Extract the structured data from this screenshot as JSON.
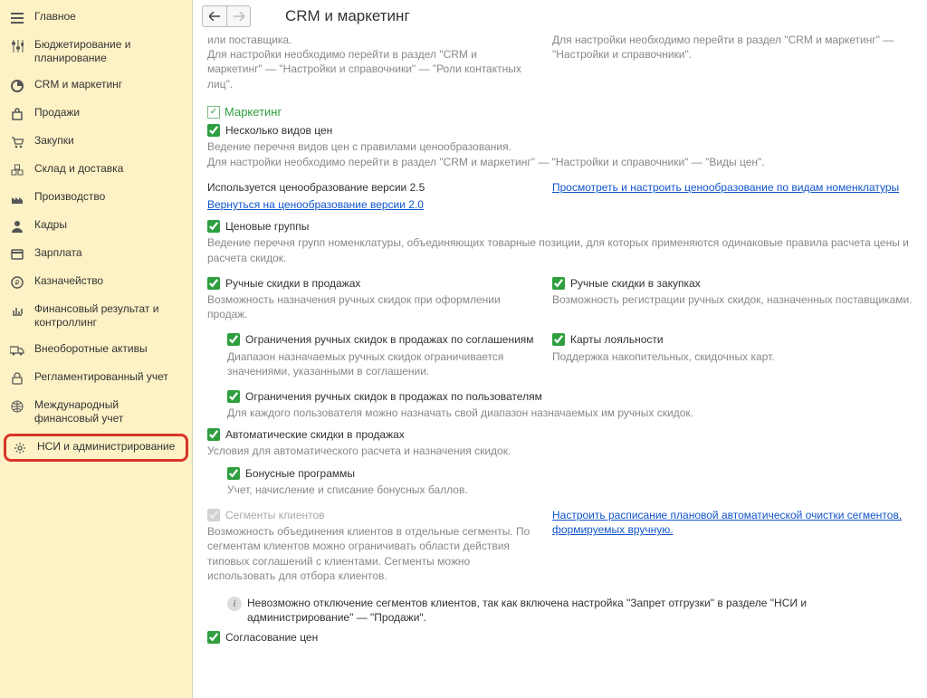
{
  "page_title": "CRM и маркетинг",
  "sidebar": [
    {
      "icon": "menu",
      "label": "Главное"
    },
    {
      "icon": "sliders",
      "label": "Бюджетирование и планирование"
    },
    {
      "icon": "pie",
      "label": "CRM и маркетинг"
    },
    {
      "icon": "bag",
      "label": "Продажи"
    },
    {
      "icon": "cart",
      "label": "Закупки"
    },
    {
      "icon": "boxes",
      "label": "Склад и доставка"
    },
    {
      "icon": "factory",
      "label": "Производство"
    },
    {
      "icon": "person",
      "label": "Кадры"
    },
    {
      "icon": "card",
      "label": "Зарплата"
    },
    {
      "icon": "coin",
      "label": "Казначейство"
    },
    {
      "icon": "chart",
      "label": "Финансовый результат и контроллинг"
    },
    {
      "icon": "truck",
      "label": "Внеоборотные активы"
    },
    {
      "icon": "lock",
      "label": "Регламентированный учет"
    },
    {
      "icon": "globe",
      "label": "Международный финансовый учет"
    },
    {
      "icon": "gear",
      "label": "НСИ и администрирование",
      "highlighted": true
    }
  ],
  "top_left_desc": "или поставщика.\nДля настройки необходимо перейти в раздел \"CRM и маркетинг\" — \"Настройки и справочники\" — \"Роли контактных лиц\".",
  "top_right_desc": "Для настройки необходимо перейти в раздел \"CRM и маркетинг\" — \"Настройки и справочники\".",
  "section_marketing": "Маркетинг",
  "cb_multiple_prices": "Несколько видов цен",
  "desc_multiple_prices": "Ведение перечня видов цен с правилами ценообразования.\nДля настройки необходимо перейти в раздел \"CRM и маркетинг\" — \"Настройки и справочники\" — \"Виды цен\".",
  "pricing_version_text": "Используется ценообразование версии 2.5",
  "pricing_version_link": "Вернуться на ценообразование версии 2.0",
  "pricing_right_link": "Просмотреть и настроить ценообразование по видам номенклатуры",
  "cb_price_groups": "Ценовые группы",
  "desc_price_groups": "Ведение перечня групп номенклатуры, объединяющих товарные позиции, для которых применяются одинаковые правила расчета цены и расчета скидок.",
  "cb_manual_sales": "Ручные скидки в продажах",
  "desc_manual_sales": "Возможность назначения ручных скидок при оформлении продаж.",
  "cb_manual_purch": "Ручные скидки в закупках",
  "desc_manual_purch": "Возможность регистрации ручных скидок, назначенных поставщиками.",
  "cb_limit_agreement": "Ограничения ручных скидок в продажах по соглашениям",
  "desc_limit_agreement": "Диапазон назначаемых ручных скидок ограничивается значениями, указанными в соглашении.",
  "cb_loyalty": "Карты лояльности",
  "desc_loyalty": "Поддержка накопительных, скидочных карт.",
  "cb_limit_users": "Ограничения ручных скидок в продажах по пользователям",
  "desc_limit_users": "Для каждого пользователя можно назначать свой диапазон назначаемых им ручных скидок.",
  "cb_auto_discounts": "Автоматические скидки в продажах",
  "desc_auto_discounts": "Условия для автоматического расчета и назначения скидок.",
  "cb_bonus": "Бонусные программы",
  "desc_bonus": "Учет, начисление и списание бонусных баллов.",
  "cb_segments": "Сегменты клиентов",
  "desc_segments": "Возможность объединения клиентов в отдельные сегменты. По сегментам клиентов можно ограничивать области действия типовых соглашений с клиентами. Сегменты можно использовать для отбора клиентов.",
  "segments_link": "Настроить расписание плановой автоматической очистки сегментов, формируемых вручную.",
  "info_segments": "Невозможно отключение сегментов клиентов, так как включена настройка \"Запрет отгрузки\" в разделе \"НСИ и администрирование\" — \"Продажи\".",
  "cb_price_approval": "Согласование цен"
}
